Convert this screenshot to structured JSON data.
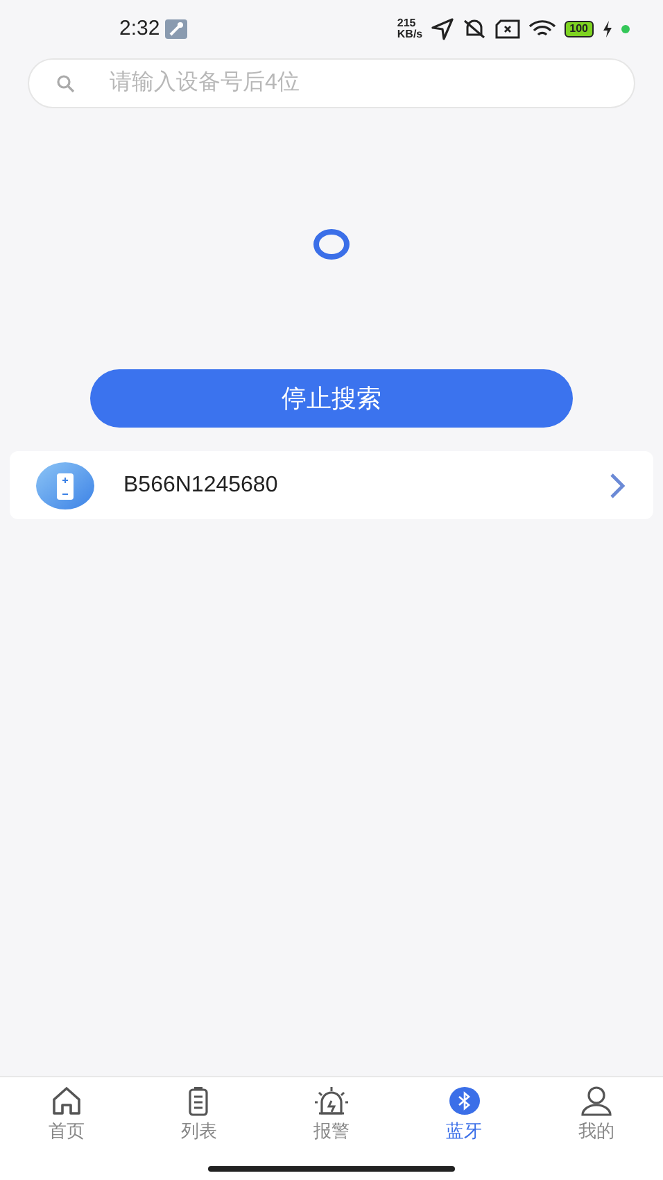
{
  "status_bar": {
    "time": "2:32",
    "speed_value": "215",
    "speed_unit": "KB/s",
    "battery": "100"
  },
  "search": {
    "placeholder": "请输入设备号后4位"
  },
  "stop_button": {
    "label": "停止搜索"
  },
  "devices": [
    {
      "name": "B566N1245680"
    }
  ],
  "tab_bar": [
    {
      "label": "首页",
      "kind": "home",
      "selected": false
    },
    {
      "label": "列表",
      "kind": "list",
      "selected": false
    },
    {
      "label": "报警",
      "kind": "alarm",
      "selected": false
    },
    {
      "label": "蓝牙",
      "kind": "bluetooth",
      "selected": true
    },
    {
      "label": "我的",
      "kind": "user",
      "selected": false
    }
  ]
}
